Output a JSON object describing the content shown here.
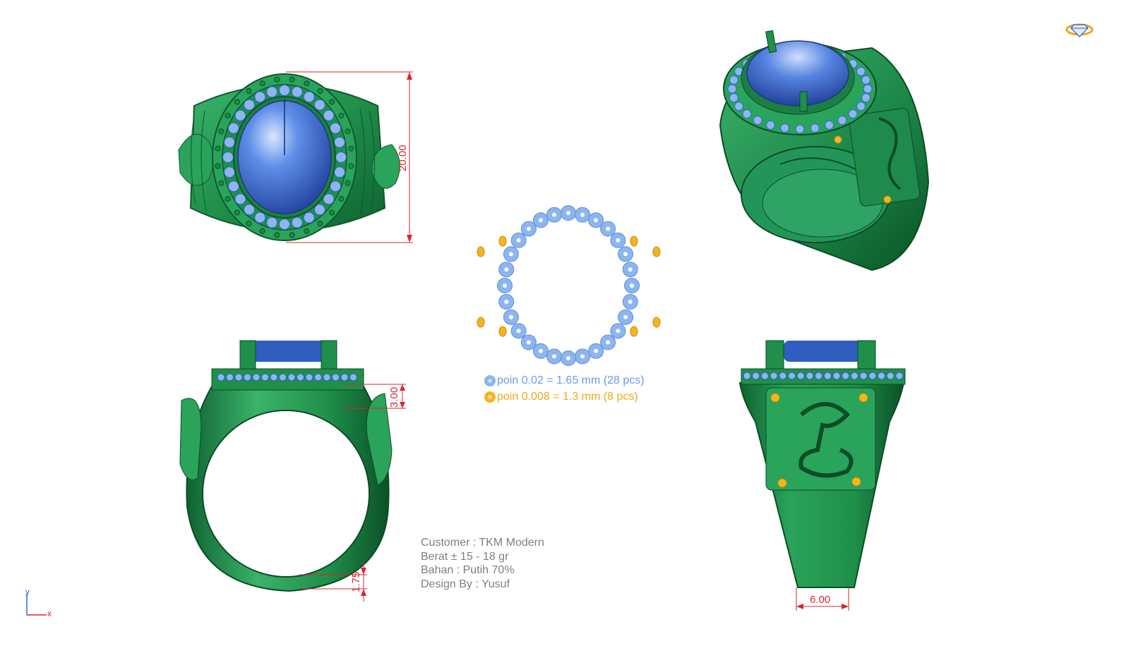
{
  "colors": {
    "metal": "#1f8f4a",
    "metal_dark": "#0f6331",
    "metal_light": "#3bb26a",
    "stone": "#3f6fd0",
    "diamond_main": "#8db5ef",
    "diamond_accent": "#f5b41e",
    "dimension": "#d8262e",
    "text_gray": "#7f7f7f"
  },
  "views": {
    "top": {
      "dimension": "20.00"
    },
    "front": {
      "dimension_top": "3.00",
      "dimension_bottom": "1.75"
    },
    "side": {
      "dimension": "6.00"
    },
    "perspective": {}
  },
  "legend": {
    "main": "poin 0.02 = 1.65 mm (28 pcs)",
    "accent": "poin 0.008 = 1.3 mm (8 pcs)"
  },
  "info": {
    "customer": "Customer : TKM Modern",
    "weight": "Berat ± 15 - 18 gr",
    "material": "Bahan : Putih 70%",
    "designer": "Design By : Yusuf"
  },
  "stone_layout": {
    "main_count": 28,
    "accent_count": 8
  },
  "axis": {
    "x": "x",
    "y": "y"
  },
  "icons": {
    "logo": "diamond-ring-logo-icon"
  }
}
